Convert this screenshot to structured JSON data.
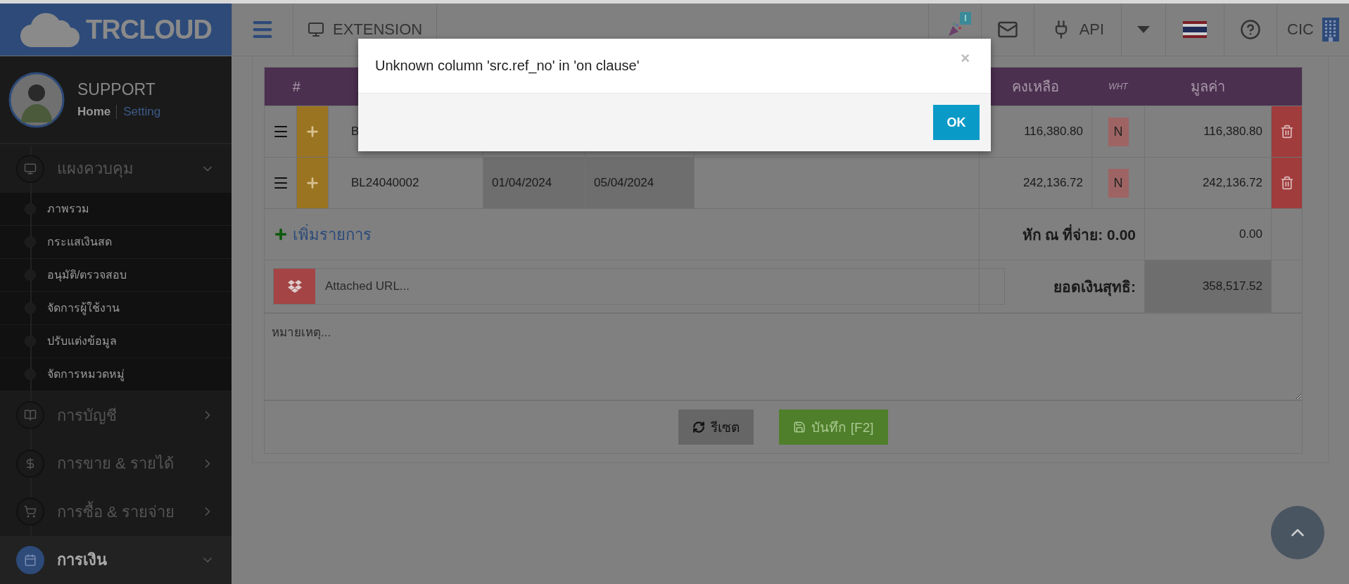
{
  "header": {
    "logo": "TRCLOUD",
    "extension": "EXTENSION",
    "notification_badge": "I",
    "api": "API",
    "company": "CIC"
  },
  "sidebar": {
    "user": {
      "name": "SUPPORT",
      "links": [
        {
          "label": "Home"
        },
        {
          "label": "Setting"
        }
      ]
    },
    "menu": [
      {
        "label": "แผงควบคุม",
        "expanded": true,
        "selected": false,
        "children": [
          {
            "label": "ภาพรวม"
          },
          {
            "label": "กระแสเงินสด"
          },
          {
            "label": "อนุมัติ/ตรวจสอบ"
          },
          {
            "label": "จัดการผู้ใช้งาน"
          },
          {
            "label": "ปรับแต่งข้อมูล"
          },
          {
            "label": "จัดการหมวดหมู่"
          }
        ]
      },
      {
        "label": "การบัญชี",
        "expanded": false,
        "selected": false
      },
      {
        "label": "การขาย & รายได้",
        "expanded": false,
        "selected": false
      },
      {
        "label": "การซื้อ & รายจ่าย",
        "expanded": false,
        "selected": false
      },
      {
        "label": "การเงิน",
        "expanded": true,
        "selected": true
      }
    ]
  },
  "table": {
    "header": {
      "number": "#",
      "balance": "คงเหลือ",
      "wht": "WHT",
      "value": "มูลค่า"
    },
    "rows": [
      {
        "document": "B",
        "balance": "116,380.80",
        "wht": "N",
        "value": "116,380.80"
      },
      {
        "document": "BL24040002",
        "date_1": "01/04/2024",
        "date_2": "05/04/2024",
        "balance": "242,136.72",
        "wht": "N",
        "value": "242,136.72"
      }
    ],
    "add_item": "เพิ่มรายการ",
    "withholding": {
      "label": "หัก ณ ที่จ่าย: 0.00",
      "value": "0.00"
    },
    "attachment": {
      "placeholder": "Attached URL..."
    },
    "net_total": {
      "label": "ยอดเงินสุทธิ:",
      "value": "358,517.52"
    },
    "remarks": {
      "placeholder": "หมายเหตุ..."
    },
    "buttons": {
      "reset": "รีเซต",
      "save": "บันทึก [F2]"
    }
  },
  "modal": {
    "message": "Unknown column 'src.ref_no' in 'on clause'",
    "close": "×",
    "ok": "OK"
  }
}
